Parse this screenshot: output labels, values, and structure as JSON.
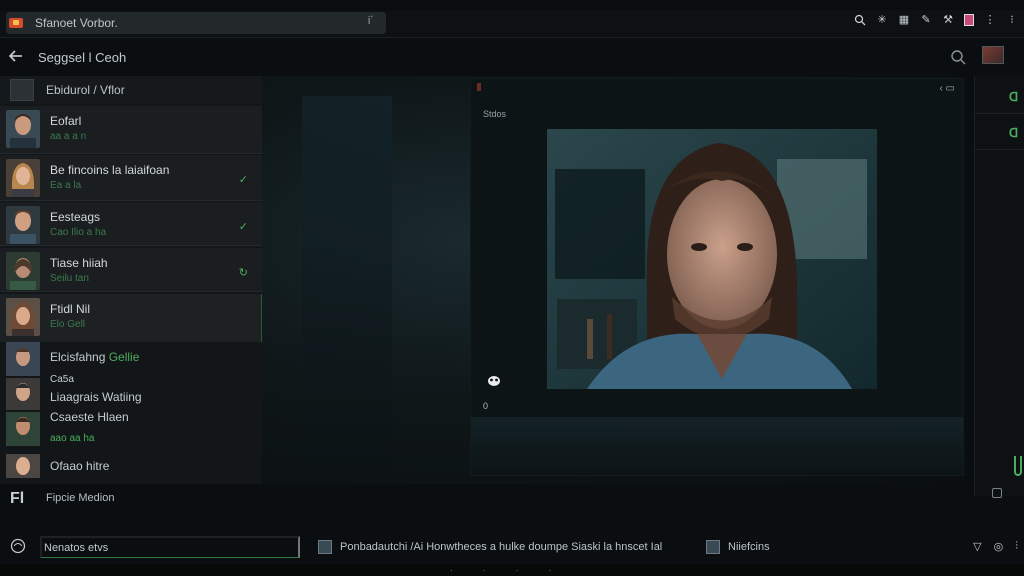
{
  "tabbar": {
    "title": "Sfanoet Vorbor.",
    "end_glyph": "i´"
  },
  "header": {
    "title": "Seggsel l Ceoh"
  },
  "sidebar": {
    "head_label": "Ebidurol / Vflor",
    "contacts": [
      {
        "name": "Eofarl",
        "sub": "aa a a n"
      },
      {
        "name": "Be fincoins la laiaifoan",
        "sub": "Ea a la",
        "check": "✓"
      },
      {
        "name": "Eesteags",
        "sub": "Cao Ilio a ha",
        "check": "✓"
      },
      {
        "name": "Tiase hiiah",
        "sub": "Seilu tan",
        "check": "↻"
      },
      {
        "name": "Ftidl Nil",
        "sub": "Elo Gell"
      }
    ],
    "items": [
      {
        "pre": "Elcisfahng ",
        "accent": "Gellie"
      },
      {
        "text": "Ca5a"
      },
      {
        "text": "Liaagrais Watiing"
      },
      {
        "text": "Csaeste Hlaen"
      },
      {
        "text": "aao aa ha"
      },
      {
        "text": "Ofaao hitre"
      }
    ],
    "footer_icon": "Fl",
    "footer_label": "Fipcie Medion"
  },
  "video": {
    "label": "Stdos",
    "close_glyph": "‹ ▭",
    "counter": "0"
  },
  "bottom": {
    "input_value": "Nenatos etvs",
    "chip1": "Ponbadautchi /Ai Honwtheces a hulke doumpe Siaski la hnscet Ial",
    "chip2": "Niiefcins"
  },
  "colors": {
    "accent_green": "#4cae5c",
    "panel_bg": "#121618",
    "logo": "#d94a2b"
  }
}
